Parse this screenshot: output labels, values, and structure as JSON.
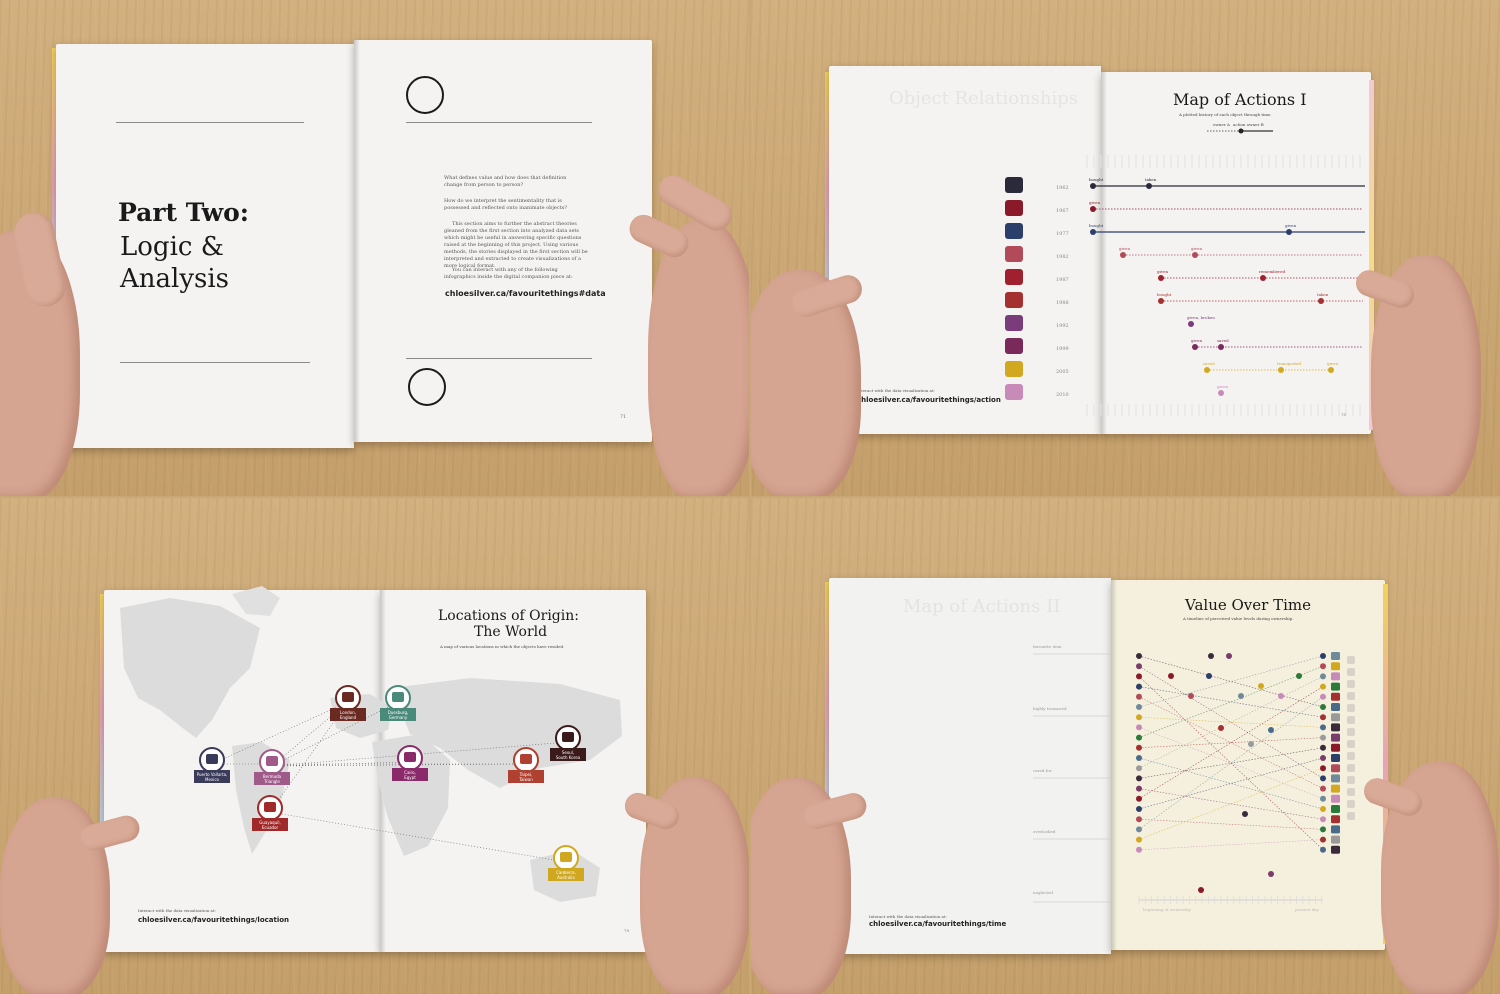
{
  "spread1": {
    "heading_bold": "Part Two:",
    "heading_line2": "Logic &",
    "heading_line3": "Analysis",
    "paragraph1": "What defines value and how does that definition change from person to person?",
    "paragraph2": "How do we interpret the sentimentality that is possessed and reflected onto inanimate objects?",
    "paragraph3": "This section aims to further the abstract theories gleaned from the first section into analyzed data sets which might be useful in answering specific questions raised at the beginning of this project. Using various methods, the stories displayed in the first section will be interpreted and extracted to create visualizations of a more logical format.",
    "paragraph4": "You can interact with any of the following infographics inside the digital companion piece at:",
    "url": "chloesilver.ca/favouritethings#data",
    "page_number": "71"
  },
  "spread2": {
    "title": "Map of Actions I",
    "subtitle": "A plotted history of each object through time.",
    "legend_a": "owner A",
    "legend_b": "action owner B",
    "interact_text": "Interact with the data visualization at:",
    "url": "chloesilver.ca/favouritethings/action",
    "years": [
      "1962",
      "1967",
      "1977",
      "1982",
      "1987",
      "1988",
      "1992",
      "1999",
      "2005",
      "2010"
    ],
    "page_number": "75",
    "chart_data": {
      "type": "line",
      "rows": [
        {
          "year": "1962",
          "color": "#2a2a3a",
          "events": [
            {
              "label": "bought"
            },
            {
              "label": "taken"
            }
          ]
        },
        {
          "year": "1967",
          "color": "#8a1a2a",
          "events": [
            {
              "label": "given"
            }
          ]
        },
        {
          "year": "1977",
          "color": "#2b3f6a",
          "events": [
            {
              "label": "bought"
            },
            {
              "label": "given"
            }
          ]
        },
        {
          "year": "1982",
          "color": "#b24a5a",
          "events": [
            {
              "label": "given"
            },
            {
              "label": "given"
            }
          ]
        },
        {
          "year": "1987",
          "color": "#a02030",
          "events": [
            {
              "label": "given"
            },
            {
              "label": "remembered"
            }
          ]
        },
        {
          "year": "1988",
          "color": "#a43030",
          "events": [
            {
              "label": "bought"
            },
            {
              "label": "taken"
            }
          ]
        },
        {
          "year": "1992",
          "color": "#7a3c7a",
          "events": [
            {
              "label": "given, broken"
            }
          ]
        },
        {
          "year": "1999",
          "color": "#7a2a5a",
          "events": [
            {
              "label": "given"
            },
            {
              "label": "saved"
            }
          ]
        },
        {
          "year": "2005",
          "color": "#d2a820",
          "events": [
            {
              "label": "saved"
            },
            {
              "label": "transported"
            },
            {
              "label": "given"
            }
          ]
        },
        {
          "year": "2010",
          "color": "#c88ab8",
          "events": [
            {
              "label": "given"
            }
          ]
        }
      ]
    }
  },
  "spread3": {
    "title_line1": "Locations of Origin:",
    "title_line2": "The World",
    "subtitle": "A map of various locations in which the objects have resided.",
    "interact_text": "Interact with the data visualization at:",
    "url": "chloesilver.ca/favouritethings/location",
    "page_number": "79",
    "pins": [
      {
        "label1": "London,",
        "label2": "England",
        "color": "#6a2a22"
      },
      {
        "label1": "Duesburg,",
        "label2": "Germany",
        "color": "#4a8a7a"
      },
      {
        "label1": "Puerto Vallarta,",
        "label2": "Mexico",
        "color": "#3a3a5a"
      },
      {
        "label1": "Bermuda",
        "label2": "Triangle",
        "color": "#a05a8a"
      },
      {
        "label1": "Cairo,",
        "label2": "Egypt",
        "color": "#8a2a6a"
      },
      {
        "label1": "Taipei,",
        "label2": "Taiwan",
        "color": "#b04030"
      },
      {
        "label1": "Seoul,",
        "label2": "South Korea",
        "color": "#3a1a1a"
      },
      {
        "label1": "Guayaquil,",
        "label2": "Ecuador",
        "color": "#a02a2a"
      },
      {
        "label1": "Canberra,",
        "label2": "Australia",
        "color": "#d0a820"
      }
    ]
  },
  "spread4": {
    "title": "Value Over Time",
    "subtitle": "A timeline of perceived value levels during ownership.",
    "levels": [
      "favourite item",
      "highly treasured",
      "cared for",
      "overlooked",
      "neglected"
    ],
    "interact_text": "Interact with the data visualization at:",
    "url": "chloesilver.ca/favouritethings/time",
    "x_start": "beginning of ownership",
    "x_end": "present day"
  },
  "colors": {
    "desk": "#c9a877",
    "paper": "#f4f3f1",
    "cream_paper": "#f5f0dd",
    "ink": "#1a1a1a"
  }
}
